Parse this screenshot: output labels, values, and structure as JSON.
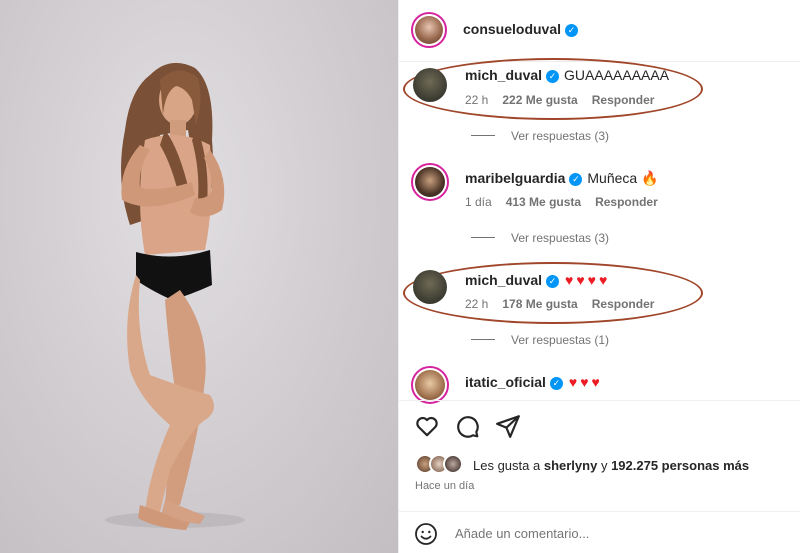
{
  "post": {
    "author": "consueloduval",
    "author_verified": true
  },
  "comments": [
    {
      "username": "mich_duval",
      "verified": true,
      "text": "GUAAAAAAAAA",
      "time": "22 h",
      "likes": "222 Me gusta",
      "reply": "Responder",
      "view_replies": "Ver respuestas (3)",
      "highlighted": true
    },
    {
      "username": "maribelguardia",
      "verified": true,
      "text": "Muñeca",
      "emoji": "fire-icon",
      "time": "1 día",
      "likes": "413 Me gusta",
      "reply": "Responder",
      "view_replies": "Ver respuestas (3)",
      "highlighted": false
    },
    {
      "username": "mich_duval",
      "verified": true,
      "hearts": 4,
      "time": "22 h",
      "likes": "178 Me gusta",
      "reply": "Responder",
      "view_replies": "Ver respuestas (1)",
      "highlighted": true
    },
    {
      "username": "itatic_oficial",
      "verified": true,
      "hearts": 3,
      "highlighted": false
    }
  ],
  "actions": {
    "like_icon": "heart-outline-icon",
    "comment_icon": "comment-bubble-icon",
    "share_icon": "paper-plane-icon"
  },
  "likes_summary": {
    "prefix": "Les gusta a",
    "user": "sherlyny",
    "connector": "y",
    "others": "192.275 personas más"
  },
  "posted_ago": "Hace un día",
  "comment_input": {
    "placeholder": "Añade un comentario..."
  },
  "colors": {
    "highlight_oval": "#a0462a",
    "verified": "#0095f6",
    "heart": "#ed1c24",
    "story_ring": "#d6249f"
  }
}
